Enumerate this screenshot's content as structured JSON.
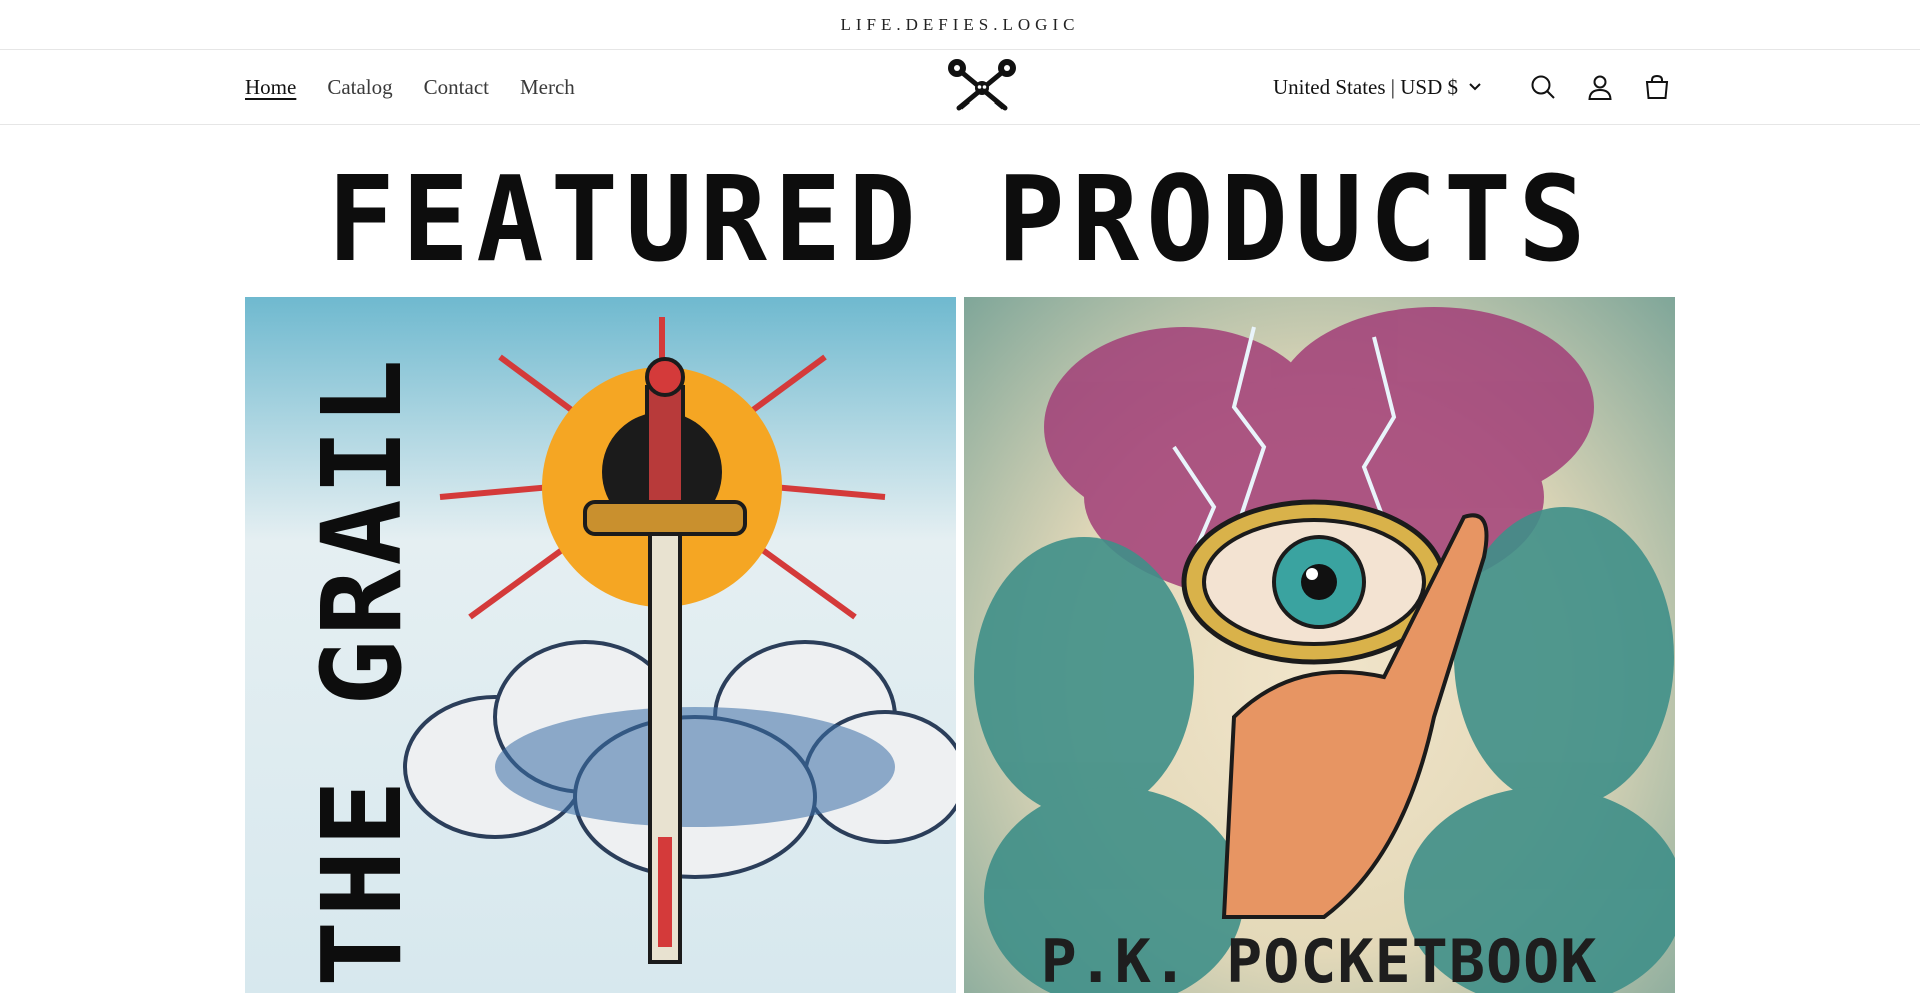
{
  "announcement": {
    "text": "LIFE.DEFIES.LOGIC"
  },
  "nav": {
    "items": [
      {
        "label": "Home",
        "active": true
      },
      {
        "label": "Catalog",
        "active": false
      },
      {
        "label": "Contact",
        "active": false
      },
      {
        "label": "Merch",
        "active": false
      }
    ]
  },
  "logo": {
    "icon": "crossed-keys-skull-logo"
  },
  "header": {
    "country_selector": "United States | USD $",
    "icons": [
      "search-icon",
      "account-icon",
      "cart-icon"
    ]
  },
  "hero": {
    "title": "FEATURED PRODUCTS"
  },
  "products": [
    {
      "art_text": "THE GRAIL"
    },
    {
      "art_text": "P.K. POCKETBOOK"
    }
  ],
  "colors": {
    "text": "#121212",
    "border": "#e6e6e6",
    "background": "#ffffff"
  }
}
